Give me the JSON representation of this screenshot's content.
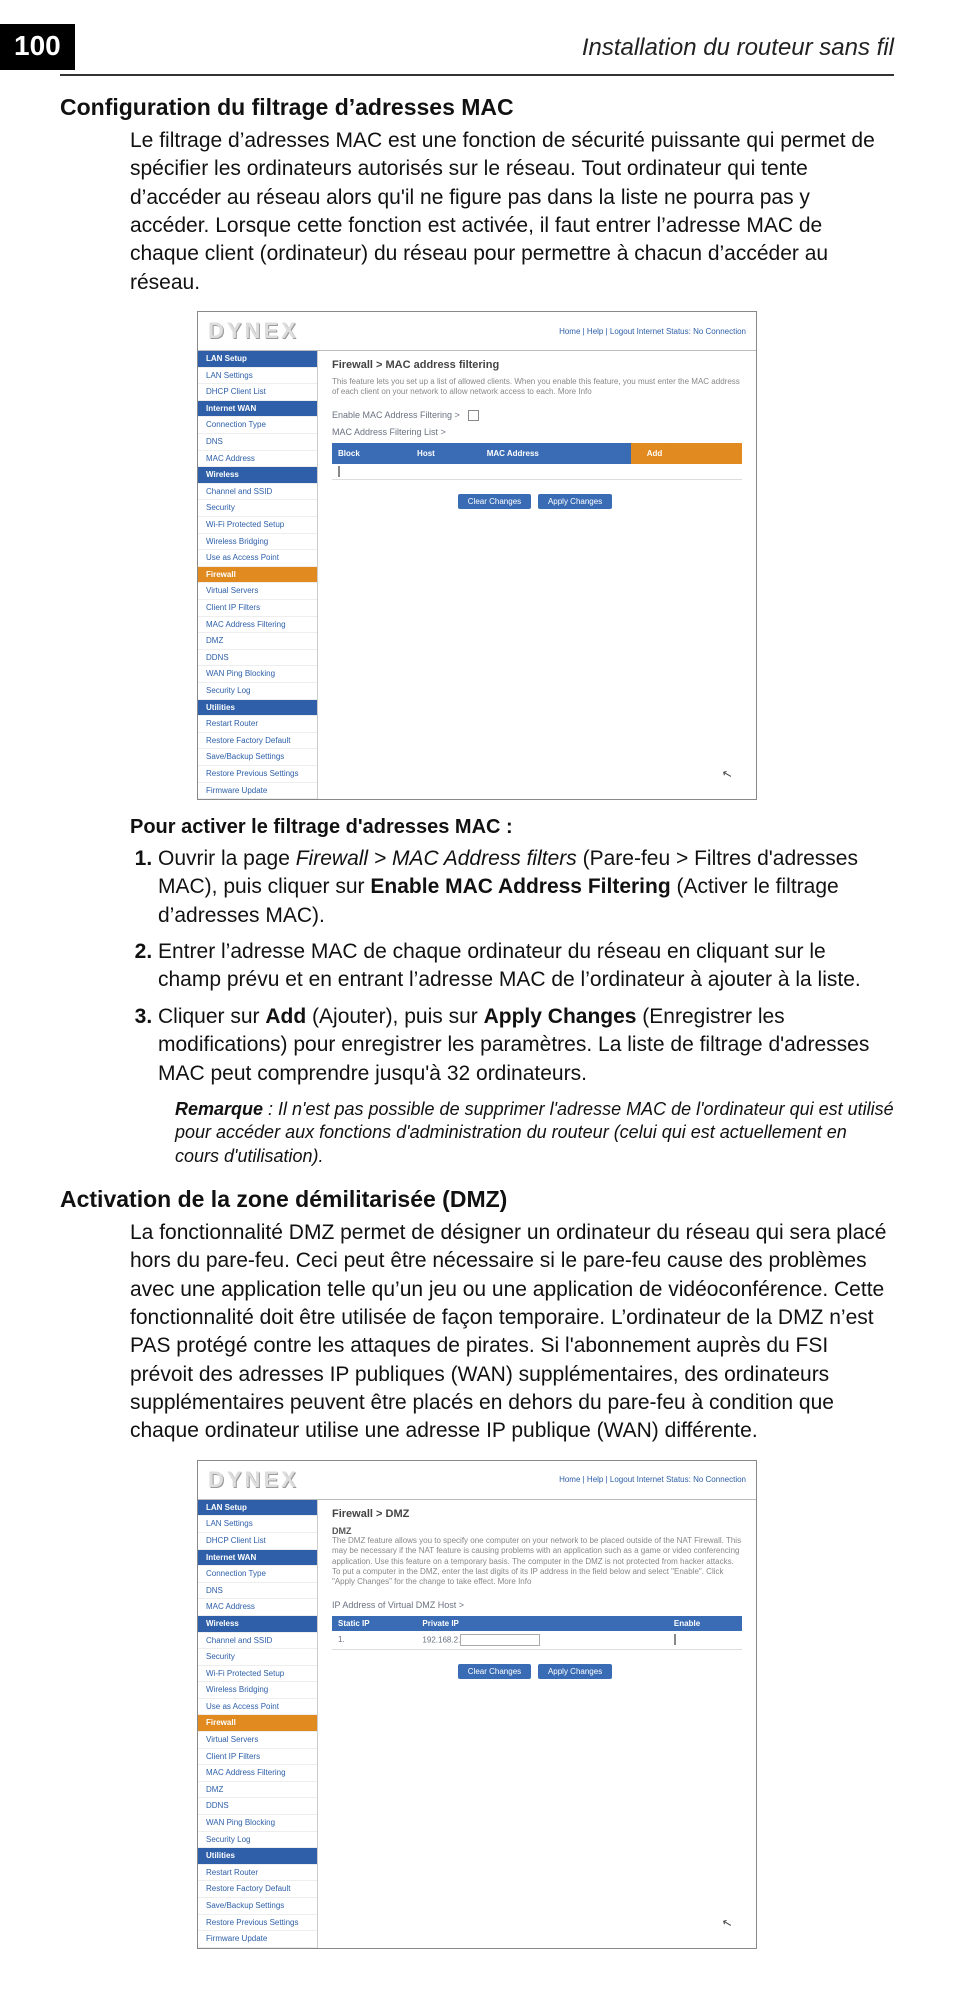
{
  "page": {
    "number": "100"
  },
  "header": {
    "running_title": "Installation du routeur sans fil"
  },
  "section1": {
    "title": "Configuration du filtrage d’adresses MAC",
    "body": "Le filtrage d’adresses MAC est une fonction de sécurité puissante qui permet de spécifier les ordinateurs autorisés sur le réseau. Tout ordinateur qui tente d’accéder au réseau alors qu'il ne figure pas dans la liste ne pourra pas y accéder. Lorsque cette fonction est activée, il faut entrer l’adresse MAC de chaque client (ordinateur) du réseau pour permettre à chacun d’accéder au réseau."
  },
  "router1": {
    "logo": "DYNEX",
    "toplinks": "Home | Help | Logout   Internet Status:  No Connection",
    "panel_title": "Firewall > MAC address filtering",
    "desc": "This feature lets you set up a list of allowed clients. When you enable this feature, you must enter the MAC address of each client on your network to allow network access to each. More Info",
    "enable_label": "Enable MAC Address Filtering >",
    "list_label": "MAC Address Filtering List >",
    "th_block": "Block",
    "th_host": "Host",
    "th_mac": "MAC Address",
    "btn_add": "Add",
    "btn_clear": "Clear Changes",
    "btn_apply": "Apply Changes",
    "nav": {
      "cat_lan": "LAN Setup",
      "lan1": "LAN Settings",
      "lan2": "DHCP Client List",
      "cat_internet": "Internet WAN",
      "wan1": "Connection Type",
      "wan2": "DNS",
      "wan3": "MAC Address",
      "cat_wireless": "Wireless",
      "wl1": "Channel and SSID",
      "wl2": "Security",
      "wl3": "Wi-Fi Protected Setup",
      "wl4": "Wireless Bridging",
      "wl5": "Use as Access Point",
      "cat_fw": "Firewall",
      "fw1": "Virtual Servers",
      "fw2": "Client IP Filters",
      "fw3": "MAC Address Filtering",
      "fw4": "DMZ",
      "fw5": "DDNS",
      "fw6": "WAN Ping Blocking",
      "fw7": "Security Log",
      "cat_util": "Utilities",
      "ut1": "Restart Router",
      "ut2": "Restore Factory Default",
      "ut3": "Save/Backup Settings",
      "ut4": "Restore Previous Settings",
      "ut5": "Firmware Update"
    }
  },
  "steps": {
    "title": "Pour activer le filtrage d'adresses MAC :",
    "s1a": "Ouvrir la page ",
    "s1b": "Firewall > MAC Address filters",
    "s1c": " (Pare-feu > Filtres d'adresses MAC), puis cliquer sur ",
    "s1d": "Enable MAC Address Filtering",
    "s1e": " (Activer le filtrage d’adresses MAC).",
    "s2": "Entrer l’adresse MAC de chaque ordinateur du réseau en cliquant sur le champ prévu et en entrant l’adresse MAC de l’ordinateur à ajouter à la liste.",
    "s3a": "Cliquer sur ",
    "s3b": "Add",
    "s3c": " (Ajouter), puis sur ",
    "s3d": "Apply Changes",
    "s3e": " (Enregistrer les modifications) pour enregistrer les paramètres. La liste de filtrage d'adresses MAC peut comprendre jusqu'à 32 ordinateurs."
  },
  "remark": {
    "label": "Remarque",
    "text": " : Il n'est pas possible de supprimer l'adresse MAC de l'ordinateur qui est utilisé pour accéder aux fonctions d'administration du routeur (celui qui est actuellement en cours d'utilisation)."
  },
  "section2": {
    "title": "Activation de la zone démilitarisée (DMZ)",
    "body": "La fonctionnalité DMZ permet de désigner un ordinateur du réseau qui sera placé hors du pare-feu. Ceci peut être nécessaire si le pare-feu cause des problèmes avec une application telle qu’un jeu ou une application de vidéoconférence. Cette fonctionnalité doit être utilisée de façon temporaire. L’ordinateur de la DMZ n’est PAS protégé contre les attaques de pirates. Si l'abonnement auprès du FSI prévoit des adresses IP publiques (WAN) supplémentaires, des ordinateurs supplémentaires peuvent être placés en dehors du pare-feu à condition que chaque ordinateur utilise une adresse IP publique (WAN) différente."
  },
  "router2": {
    "logo": "DYNEX",
    "toplinks": "Home | Help | Logout   Internet Status:  No Connection",
    "panel_title": "Firewall > DMZ",
    "sub": "DMZ",
    "desc": "The DMZ feature allows you to specify one computer on your network to be placed outside of the NAT Firewall. This may be necessary if the NAT feature is causing problems with an application such as a game or video conferencing application. Use this feature on a temporary basis. The computer in the DMZ is not protected from hacker attacks. To put a computer in the DMZ, enter the last digits of its IP address in the field below and select \"Enable\". Click \"Apply Changes\" for the change to take effect. More Info",
    "iplabel": "IP Address of Virtual DMZ Host >",
    "th_static": "Static IP",
    "th_private": "Private IP",
    "th_enable": "Enable",
    "prefix": "192.168.2.",
    "btn_clear": "Clear Changes",
    "btn_apply": "Apply Changes"
  }
}
